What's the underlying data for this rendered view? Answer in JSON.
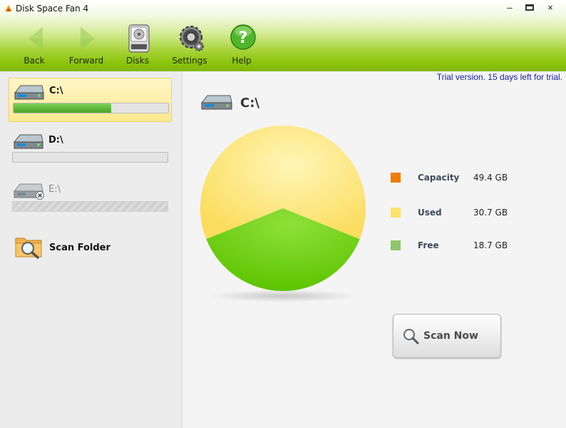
{
  "window": {
    "title": "Disk Space Fan 4",
    "controls": {
      "minimize": "–",
      "close": "×"
    }
  },
  "toolbar": {
    "back_label": "Back",
    "forward_label": "Forward",
    "disks_label": "Disks",
    "settings_label": "Settings",
    "help_label": "Help",
    "help_glyph": "?"
  },
  "sidebar": {
    "drives": [
      {
        "label": "C:\\",
        "used_fraction": 0.63,
        "state": "selected",
        "icon": "hard-drive-icon"
      },
      {
        "label": "D:\\",
        "used_fraction": 0.0,
        "state": "normal",
        "icon": "hard-drive-icon"
      },
      {
        "label": "E:\\",
        "used_fraction": 0.0,
        "state": "unavailable",
        "icon": "hard-drive-unavailable-icon"
      }
    ],
    "scan_folder_label": "Scan Folder"
  },
  "main": {
    "trial_notice": "Trial version. 15 days left for trial.",
    "current_drive_label": "C:\\",
    "legend": [
      {
        "name": "Capacity",
        "value": "49.4 GB",
        "color": "#f07d00"
      },
      {
        "name": "Used",
        "value": "30.7 GB",
        "color": "#fde26a"
      },
      {
        "name": "Free",
        "value": "18.7 GB",
        "color": "#8fc56a"
      }
    ],
    "scan_button_label": "Scan Now"
  },
  "chart_data": {
    "type": "pie",
    "categories": [
      "Used",
      "Free"
    ],
    "values": [
      30.7,
      18.7
    ],
    "colors": [
      "#fde26a",
      "#6ccb10"
    ]
  },
  "colors": {
    "accent_green": "#8cc40c",
    "trial_text": "#1a23a3",
    "selected_drive_bg": "#fde98f"
  }
}
